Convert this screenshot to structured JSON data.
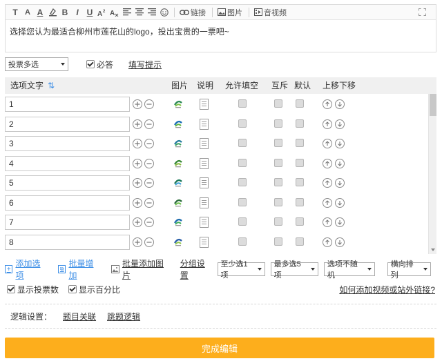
{
  "toolbar": {
    "items": [
      "T",
      "A",
      "A",
      "B",
      "I",
      "U"
    ],
    "link_label": "链接",
    "image_label": "图片",
    "video_label": "音视频"
  },
  "question": {
    "text": "选择您认为最适合柳州市莲花山的logo，投出宝贵的一票吧~"
  },
  "settings": {
    "type_select": "投票多选",
    "required_label": "必答",
    "required_checked": true,
    "hint_link": "填写提示"
  },
  "table": {
    "headers": {
      "option_text": "选项文字",
      "image": "图片",
      "desc": "说明",
      "allow_fill": "允许填空",
      "exclusive": "互斥",
      "default": "默认",
      "move": "上移下移"
    },
    "options": [
      "1",
      "2",
      "3",
      "4",
      "5",
      "6",
      "7",
      "8"
    ]
  },
  "actions": {
    "add_option": "添加选项",
    "batch_add": "批量增加",
    "batch_add_image": "批量添加图片",
    "group_settings": "分组设置",
    "min_select": "至少选1项",
    "max_select": "最多选5项",
    "random": "选项不随机",
    "layout": "横向排列"
  },
  "stats": {
    "show_votes": "显示投票数",
    "show_percent": "显示百分比",
    "help_link": "如何添加视频或站外链接?"
  },
  "logic": {
    "label": "逻辑设置：",
    "link1": "题目关联",
    "link2": "跳题逻辑"
  },
  "finish_button": "完成编辑",
  "colors": {
    "accent_blue": "#3c8ee6",
    "finish_orange": "#fdae1c"
  }
}
